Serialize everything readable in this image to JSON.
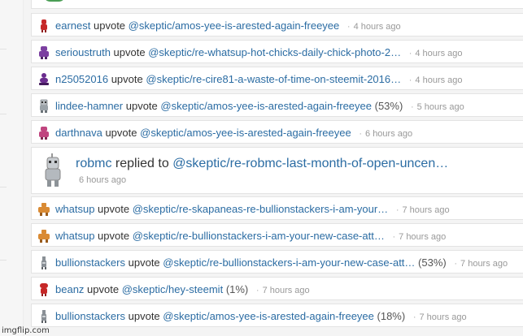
{
  "feed": {
    "rows": [
      {
        "user": "earnest",
        "verb": "upvote",
        "link": "@skeptic/amos-yee-is-arested-again-freeyee",
        "pct": "",
        "time": "4 hours ago",
        "avatar_icon": "red-robot-avatar-icon",
        "avatar_color": "#c62828"
      },
      {
        "user": "serioustruth",
        "verb": "upvote",
        "link": "@skeptic/re-whatsup-hot-chicks-daily-chick-photo-2…",
        "pct": "",
        "time": "4 hours ago",
        "avatar_icon": "purple-robot-avatar-icon",
        "avatar_color": "#7b3fa0"
      },
      {
        "user": "n25052016",
        "verb": "upvote",
        "link": "@skeptic/re-cire81-a-waste-of-time-on-steemit-2016…",
        "pct": "",
        "time": "4 hours ago",
        "avatar_icon": "purple-robot-avatar-icon",
        "avatar_color": "#6a2c8e"
      },
      {
        "user": "lindee-hamner",
        "verb": "upvote",
        "link": "@skeptic/amos-yee-is-arested-again-freeyee",
        "pct": "(53%)",
        "time": "5 hours ago",
        "avatar_icon": "gray-robot-avatar-icon",
        "avatar_color": "#9aa2a8"
      },
      {
        "user": "darthnava",
        "verb": "upvote",
        "link": "@skeptic/amos-yee-is-arested-again-freeyee",
        "pct": "",
        "time": "6 hours ago",
        "avatar_icon": "pink-robot-avatar-icon",
        "avatar_color": "#c0457f"
      }
    ],
    "reply": {
      "user": "robmc",
      "verb": "replied to",
      "link": "@skeptic/re-robmc-last-month-of-open-uncen…",
      "time": "6 hours ago",
      "avatar_icon": "silver-robot-avatar-icon"
    },
    "rows2": [
      {
        "user": "whatsup",
        "verb": "upvote",
        "link": "@skeptic/re-skapaneas-re-bullionstackers-i-am-your…",
        "pct": "",
        "time": "7 hours ago",
        "avatar_icon": "orange-robot-avatar-icon",
        "avatar_color": "#d98a33"
      },
      {
        "user": "whatsup",
        "verb": "upvote",
        "link": "@skeptic/re-bullionstackers-i-am-your-new-case-att…",
        "pct": "",
        "time": "7 hours ago",
        "avatar_icon": "orange-robot-avatar-icon",
        "avatar_color": "#d98a33"
      },
      {
        "user": "bullionstackers",
        "verb": "upvote",
        "link": "@skeptic/re-bullionstackers-i-am-your-new-case-att…",
        "pct": "(53%)",
        "time": "7 hours ago",
        "avatar_icon": "gray-robot-avatar-icon",
        "avatar_color": "#8a9096"
      },
      {
        "user": "beanz",
        "verb": "upvote",
        "link": "@skeptic/hey-steemit",
        "pct": "(1%)",
        "time": "7 hours ago",
        "avatar_icon": "red-robot-avatar-icon",
        "avatar_color": "#c62828"
      },
      {
        "user": "bullionstackers",
        "verb": "upvote",
        "link": "@skeptic/amos-yee-is-arested-again-freeyee",
        "pct": "(18%)",
        "time": "7 hours ago",
        "avatar_icon": "gray-robot-avatar-icon",
        "avatar_color": "#8a9096"
      }
    ]
  },
  "watermark": "imgflip.com"
}
